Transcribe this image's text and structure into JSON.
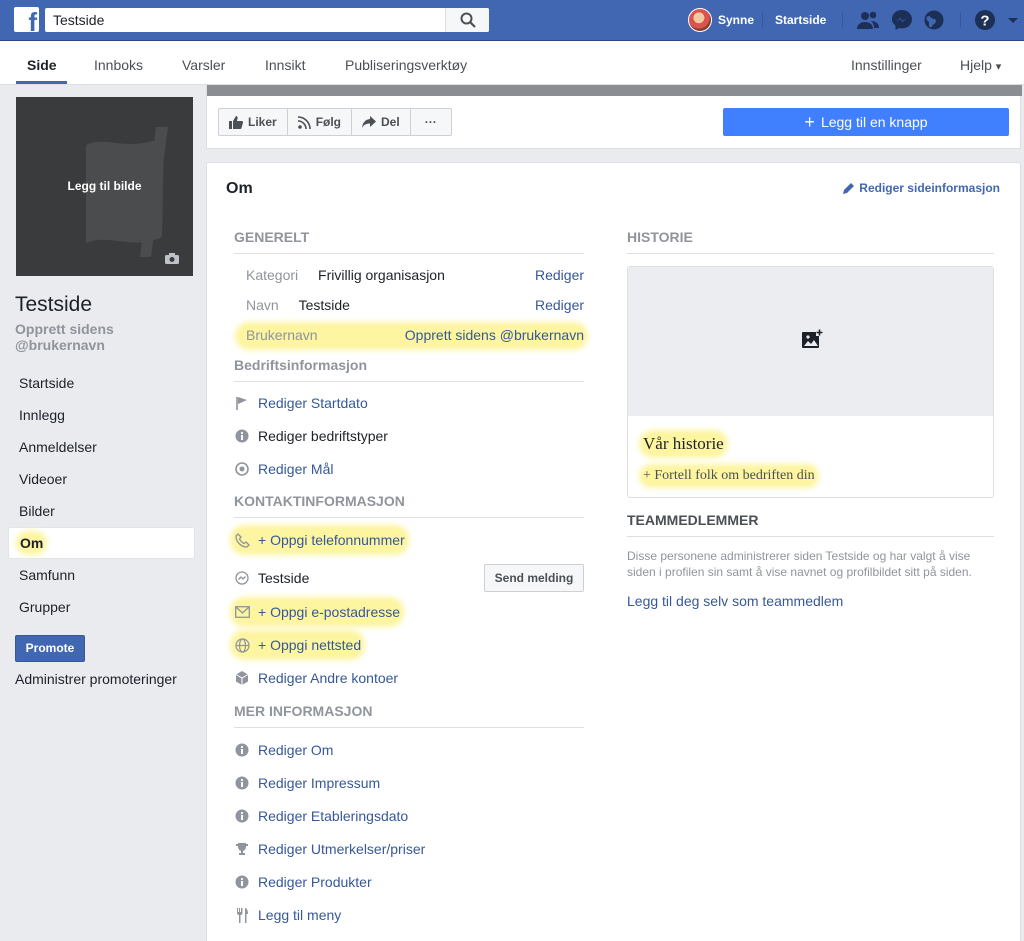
{
  "topbar": {
    "logo": "f",
    "search_value": "Testside",
    "search_icon": "search-icon",
    "user_name": "Synne",
    "home_label": "Startside",
    "icons": [
      "friends-icon",
      "messenger-icon",
      "globe-icon",
      "help-icon"
    ],
    "brand_color": "#4267b2"
  },
  "pagenav": {
    "tabs": [
      "Side",
      "Innboks",
      "Varsler",
      "Innsikt",
      "Publiseringsverktøy"
    ],
    "active_tab": "Side",
    "right": [
      "Innstillinger",
      "Hjelp"
    ],
    "help_caret": "▾"
  },
  "left": {
    "add_photo": "Legg til bilde",
    "page_name": "Testside",
    "create_handle": "Opprett sidens @brukernavn",
    "nav": [
      "Startside",
      "Innlegg",
      "Anmeldelser",
      "Videoer",
      "Bilder",
      "Om",
      "Samfunn",
      "Grupper"
    ],
    "active_nav": "Om",
    "promote": "Promote",
    "manage_promotions": "Administrer promoteringer"
  },
  "actionbar": {
    "like": "Liker",
    "follow": "Følg",
    "share": "Del",
    "more": "···",
    "add_button": "Legg til en knapp",
    "add_button_color": "#4080ff"
  },
  "about": {
    "title": "Om",
    "edit_page_info": "Rediger sideinformasjon",
    "general": {
      "heading": "GENERELT",
      "category_key": "Kategori",
      "category_value": "Frivillig organisasjon",
      "name_key": "Navn",
      "name_value": "Testside",
      "username_key": "Brukernavn",
      "username_value": "Opprett sidens @brukernavn",
      "edit": "Rediger"
    },
    "business": {
      "heading": "Bedriftsinformasjon",
      "items": [
        "Rediger Startdato",
        "Rediger bedriftstyper",
        "Rediger Mål"
      ]
    },
    "contact": {
      "heading": "KONTAKTINFORMASJON",
      "phone": "+ Oppgi telefonnummer",
      "messenger_name": "Testside",
      "send_message": "Send melding",
      "email": "+ Oppgi e-postadresse",
      "website": "+ Oppgi nettsted",
      "other_accounts": "Rediger Andre kontoer"
    },
    "more": {
      "heading": "MER INFORMASJON",
      "items": [
        "Rediger Om",
        "Rediger Impressum",
        "Rediger Etableringsdato",
        "Rediger Utmerkelser/priser",
        "Rediger Produkter",
        "Legg til meny"
      ]
    },
    "story": {
      "heading": "HISTORIE",
      "title": "Vår historie",
      "add": "+ Fortell folk om bedriften din"
    },
    "team": {
      "heading": "TEAMMEDLEMMER",
      "description": "Disse personene administrerer siden Testside og har valgt å vise siden i profilen sin samt å vise navnet og profilbildet sitt på siden.",
      "add_self": "Legg til deg selv som teammedlem"
    },
    "highlight_color": "#fdf5a0"
  }
}
